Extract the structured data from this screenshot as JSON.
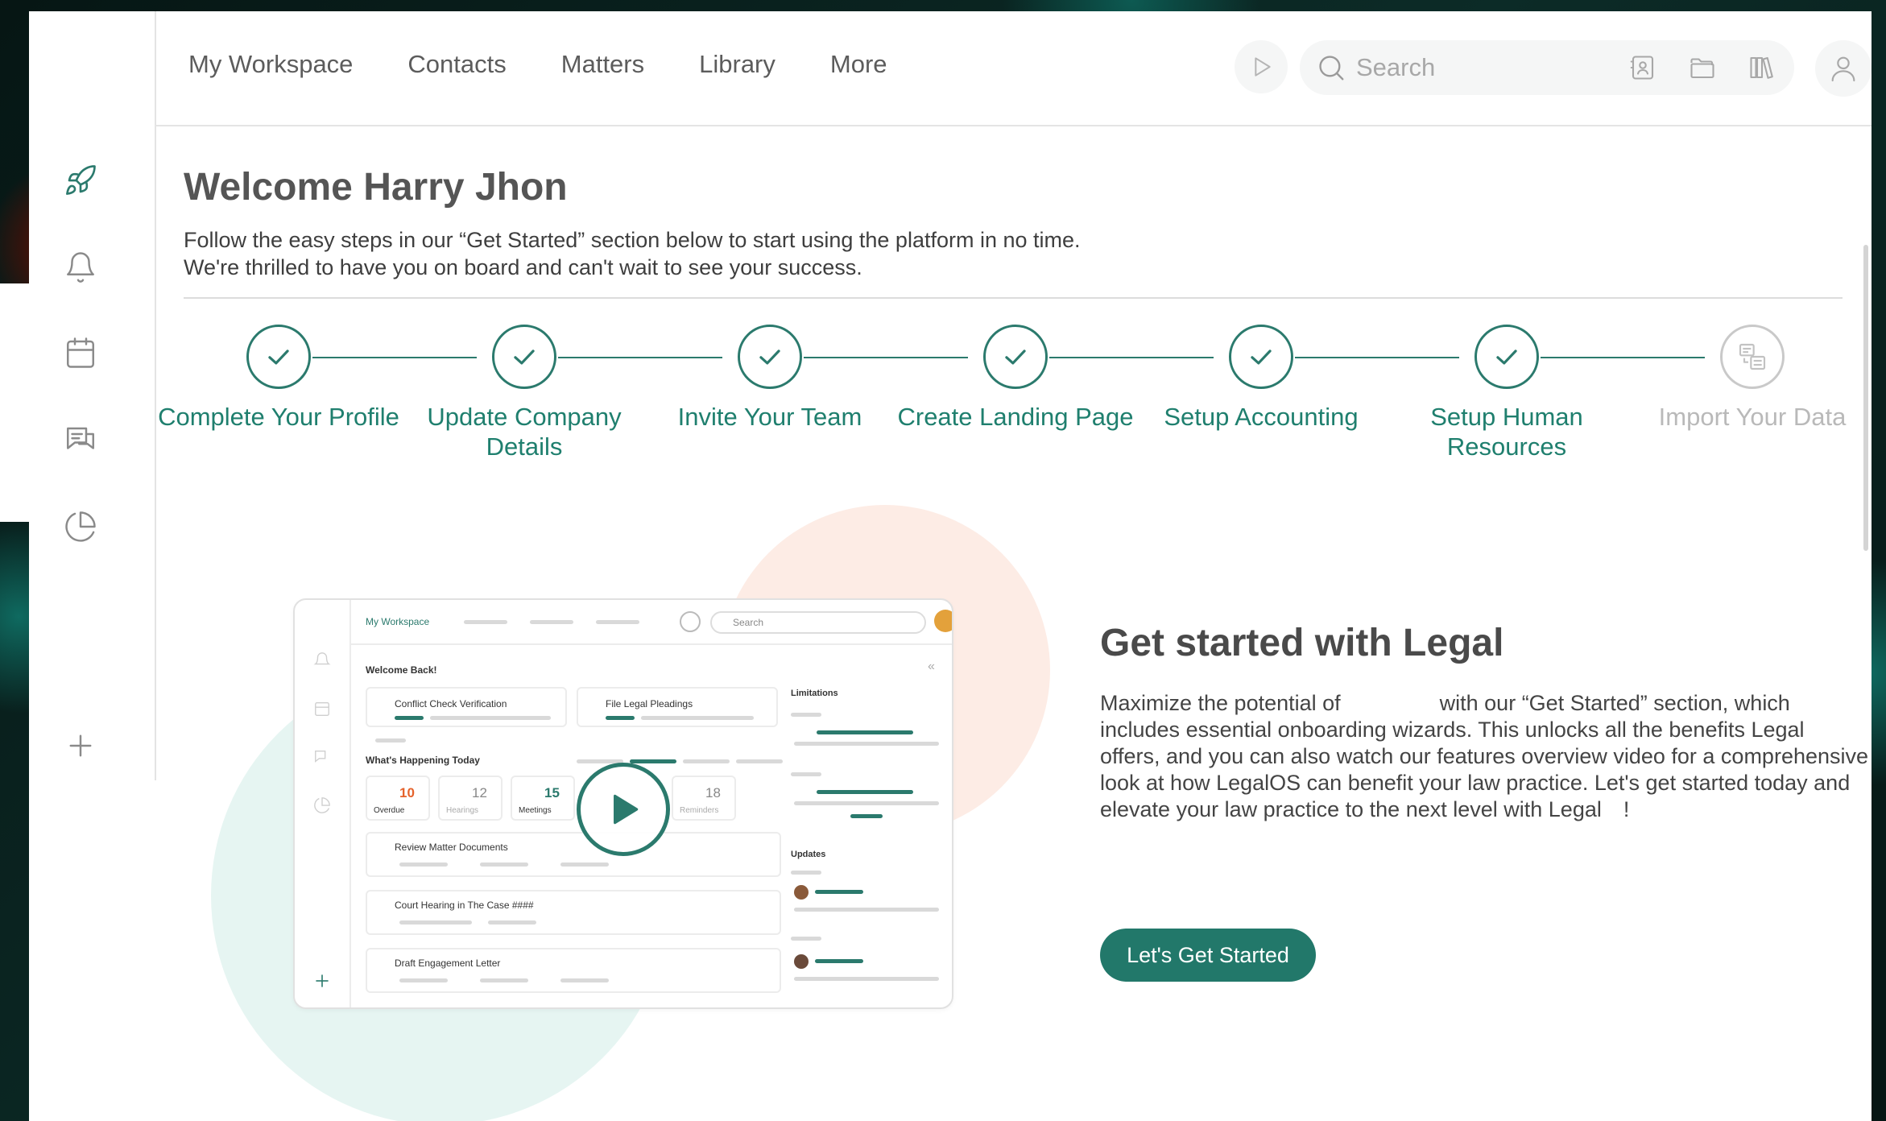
{
  "nav": {
    "items": [
      "My Workspace",
      "Contacts",
      "Matters",
      "Library",
      "More"
    ]
  },
  "search": {
    "placeholder": "Search"
  },
  "sidebar": {
    "icons": [
      "rocket-icon",
      "bell-icon",
      "calendar-icon",
      "chat-icon",
      "pie-chart-icon",
      "plus-icon"
    ]
  },
  "welcome": {
    "title": "Welcome Harry Jhon",
    "line1": "Follow the easy steps in our “Get Started” section below to start using the platform in no time.",
    "line2": "We're thrilled to have you on board and can't wait to see your success."
  },
  "steps": [
    {
      "label": "Complete Your Profile",
      "done": true
    },
    {
      "label": "Update Company Details",
      "done": true
    },
    {
      "label": "Invite Your Team",
      "done": true
    },
    {
      "label": "Create Landing Page",
      "done": true
    },
    {
      "label": "Setup Accounting",
      "done": true
    },
    {
      "label": "Setup Human Resources",
      "done": true
    },
    {
      "label": "Import Your Data",
      "done": false
    }
  ],
  "mockup": {
    "workspace": "My Workspace",
    "search": "Search",
    "welcome_back": "Welcome Back!",
    "conflict": "Conflict Check Verification",
    "pleadings": "File Legal Pleadings",
    "happening": "What's Happening Today",
    "limitations": "Limitations",
    "updates": "Updates",
    "stats": [
      {
        "value": "10",
        "label": "Overdue"
      },
      {
        "value": "12",
        "label": "Hearings"
      },
      {
        "value": "15",
        "label": "Meetings"
      },
      {
        "value": "18",
        "label": "Reminders"
      }
    ],
    "tasks": [
      "Review Matter Documents",
      "Court Hearing in The Case ####",
      "Draft Engagement Letter"
    ]
  },
  "get_started": {
    "title": "Get started with Legal",
    "body": "Maximize the potential of      with our “Get Started” section, which includes essential onboarding wizards. This unlocks all the benefits Legal  offers, and you can also watch our features overview video for a comprehensive look at how LegalOS can benefit your law practice. Let's get started today and elevate your law practice to the next level with Legal !",
    "button": "Let's Get Started"
  },
  "colors": {
    "accent": "#22786a",
    "step_done": "#2b7a6d",
    "step_pending": "#c9c9c9"
  }
}
